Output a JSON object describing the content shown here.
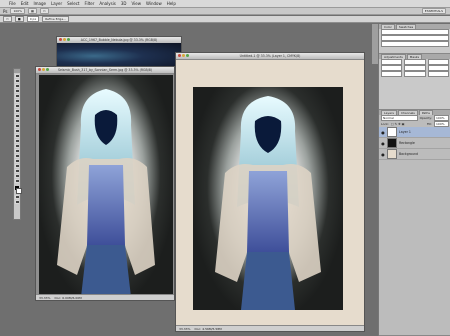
{
  "menubar": {
    "items": [
      "File",
      "Edit",
      "Image",
      "Layer",
      "Select",
      "Filter",
      "Analysis",
      "3D",
      "View",
      "Window",
      "Help"
    ]
  },
  "appbar": {
    "zoom": "100%",
    "workspace": "ESSENTIALS"
  },
  "options": {
    "feather": "0 px",
    "refine": "Refine Edge..."
  },
  "documents": {
    "back": {
      "title": "ACC_1967_Bubble_Nebula.jpg @ 33.3% (RGB/8)"
    },
    "left": {
      "title": "Seismic_Bush_317_by_Sonnian_Serm.jpg @ 33.3% (RGB/8)",
      "status_zoom": "33.33%",
      "status_doc": "Doc: 6.00M/6.00M"
    },
    "right": {
      "title": "Untitled-1 @ 33.3% (Layer 1, CMYK/8)",
      "status_zoom": "33.33%",
      "status_doc": "Doc: 4.56M/5.58M"
    }
  },
  "panels": {
    "color_tabs": [
      "Color",
      "Swatches"
    ],
    "adjust_tabs": [
      "Adjustments",
      "Masks"
    ],
    "layers_tabs": [
      "Layers",
      "Channels",
      "Paths"
    ],
    "blend_mode": "Normal",
    "opacity_label": "Opacity:",
    "opacity_value": "100%",
    "fill_label": "Fill:",
    "fill_value": "100%",
    "lock_label": "Lock:",
    "layers": [
      {
        "name": "Layer 1",
        "active": true
      },
      {
        "name": "Rectangle",
        "active": false
      },
      {
        "name": "Background",
        "active": false
      }
    ]
  },
  "colors": {
    "paper": "#e6dccd",
    "selection": "#a6b8d6"
  }
}
